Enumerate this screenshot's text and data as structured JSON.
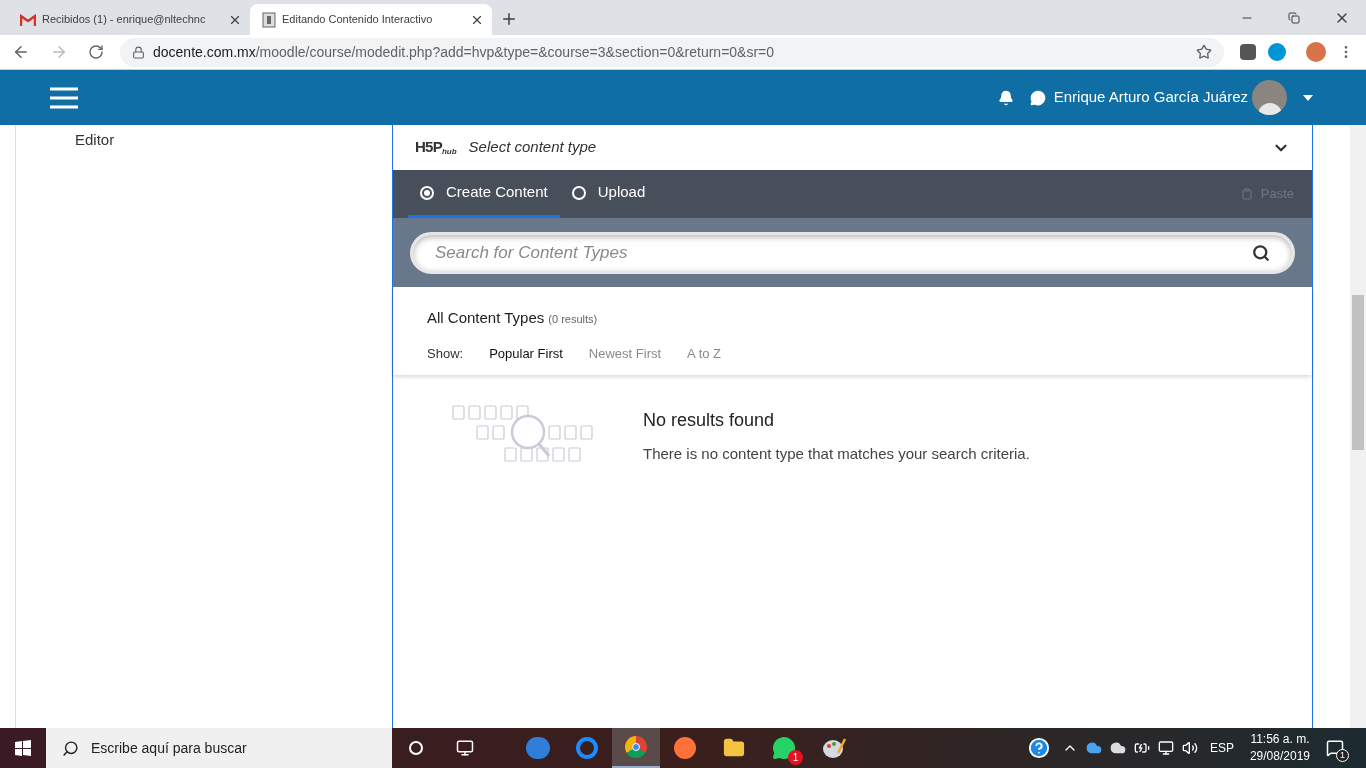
{
  "browser": {
    "tabs": [
      {
        "title": "Recibidos (1) - enrique@nltechnc",
        "selected": false,
        "kind": "mail"
      },
      {
        "title": "Editando Contenido Interactivo",
        "selected": true,
        "kind": "page"
      }
    ],
    "url_domain": "docente.com.mx",
    "url_path": "/moodle/course/modedit.php?add=hvp&type=&course=3&section=0&return=0&sr=0"
  },
  "header": {
    "user_name": "Enrique Arturo García Juárez"
  },
  "sidebar": {
    "items": [
      "Editor"
    ]
  },
  "hub": {
    "logo": {
      "main": "H5P",
      "sub": "hub"
    },
    "title": "Select content type",
    "tabs": [
      {
        "label": "Create Content",
        "selected": true
      },
      {
        "label": "Upload",
        "selected": false
      }
    ],
    "paste_label": "Paste",
    "search": {
      "placeholder": "Search for Content Types"
    },
    "list_title": "All Content Types",
    "results_count": "(0 results)",
    "show_label": "Show:",
    "sort_options": [
      {
        "label": "Popular First",
        "selected": true
      },
      {
        "label": "Newest First",
        "selected": false
      },
      {
        "label": "A to Z",
        "selected": false
      }
    ],
    "empty": {
      "title": "No results found",
      "message": "There is no content type that matches your search criteria."
    }
  },
  "taskbar": {
    "search_placeholder": "Escribe aquí para buscar",
    "whatsapp_badge": "1",
    "language": "ESP",
    "time": "11:56 a. m.",
    "date": "29/08/2019",
    "notification_count": "1"
  }
}
